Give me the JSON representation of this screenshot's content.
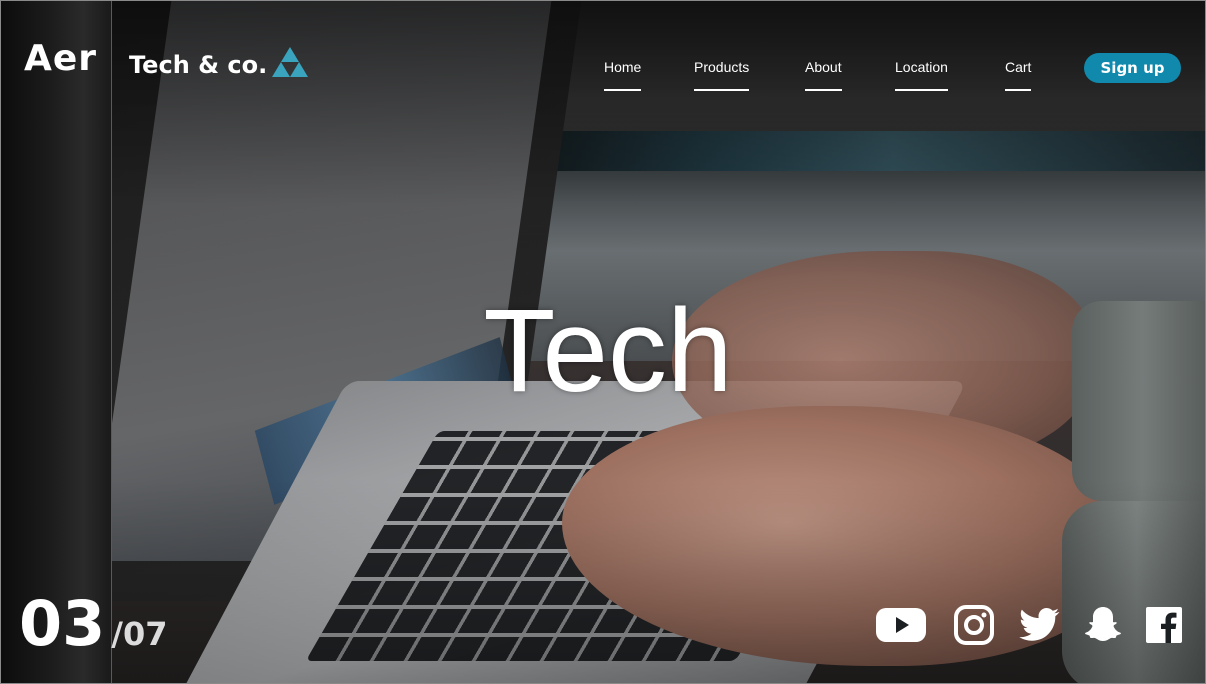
{
  "sidebar": {
    "brand": "Aer"
  },
  "header": {
    "brand": "Tech & co.",
    "nav": [
      "Home",
      "Products",
      "About",
      "Location",
      "Cart"
    ],
    "signup_label": "Sign up"
  },
  "hero": {
    "title": "Tech"
  },
  "slider": {
    "current": "03",
    "total": "/07"
  },
  "socials": [
    "youtube-icon",
    "instagram-icon",
    "twitter-icon",
    "snapchat-icon",
    "facebook-icon"
  ],
  "colors": {
    "accent": "#1189ac",
    "logo": "#3aa3bd",
    "text": "#ffffff",
    "panel": "#1a1a1a"
  }
}
